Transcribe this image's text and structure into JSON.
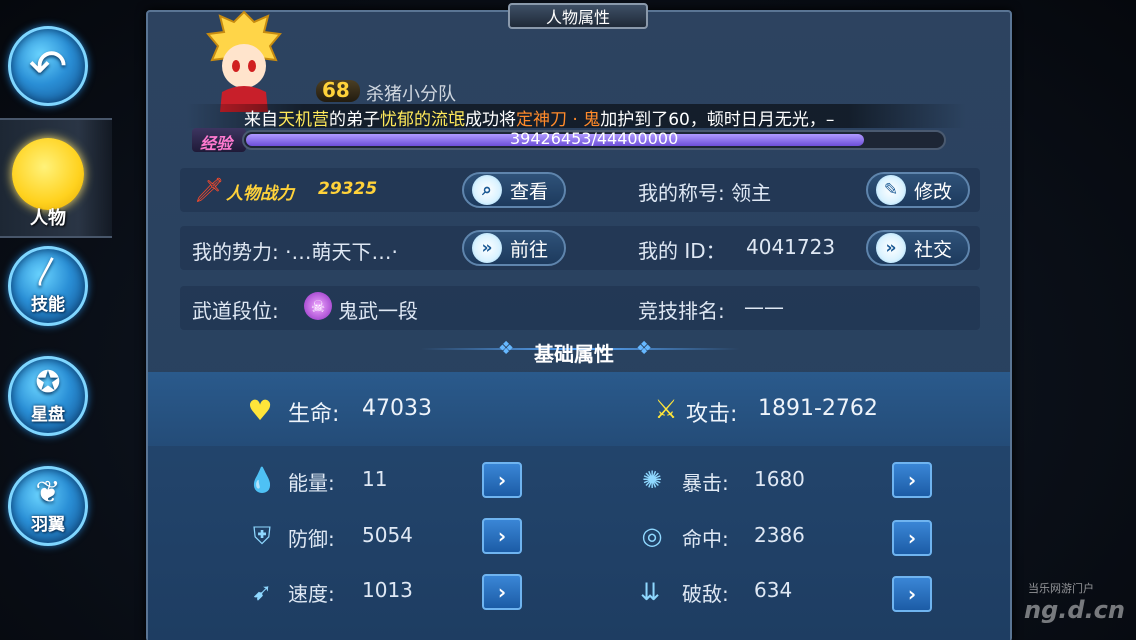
{
  "panel_title": "人物属性",
  "nav": {
    "character": "人物",
    "skill": "技能",
    "star": "星盘",
    "wings": "羽翼"
  },
  "player": {
    "level": "68",
    "team": "杀猪小分队"
  },
  "broadcast": {
    "p1": "来自",
    "camp": "天机营",
    "p2": "的弟子",
    "name": "忧郁的流氓",
    "p3": "成功将",
    "item": "定神刀 · 鬼",
    "p4": "加护到了60，顿时日月无光，–"
  },
  "exp": {
    "label": "经验",
    "current": 39426453,
    "max": 44400000,
    "text": "39426453/44400000",
    "fraction": 0.888
  },
  "power": {
    "label": "人物战力",
    "value": "29325",
    "view_btn": "查看"
  },
  "title_row": {
    "label": "我的称号: 领主",
    "btn": "修改"
  },
  "faction": {
    "label": "我的势力: ·…萌天下…·",
    "btn": "前往"
  },
  "id_row": {
    "label": "我的 ID：",
    "value": "4041723",
    "btn": "社交"
  },
  "rank": {
    "label": "武道段位:",
    "value": "鬼武一段"
  },
  "arena": {
    "label": "竞技排名:",
    "value": "——"
  },
  "section_title": "基础属性",
  "main_stats": {
    "hp_label": "生命:",
    "hp": "47033",
    "atk_label": "攻击:",
    "atk": "1891-2762"
  },
  "stats": {
    "energy_label": "能量:",
    "energy": "11",
    "crit_label": "暴击:",
    "crit": "1680",
    "def_label": "防御:",
    "def": "5054",
    "hit_label": "命中:",
    "hit": "2386",
    "spd_label": "速度:",
    "spd": "1013",
    "pen_label": "破敌:",
    "pen": "634"
  },
  "watermark": {
    "line1": "当乐网游门户",
    "line2": "ng.d.cn"
  },
  "colors": {
    "accent": "#ffe95a",
    "highlight": "#ff8a2a",
    "exp_bar": "#8c75ee",
    "button_blue": "#2a74c8"
  }
}
